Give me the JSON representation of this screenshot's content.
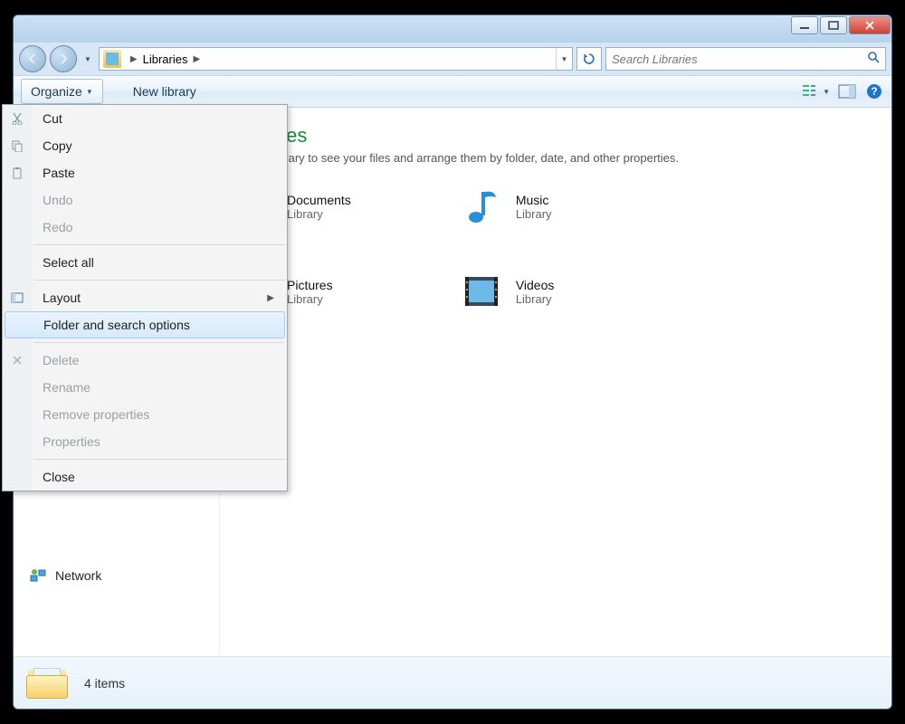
{
  "address": {
    "location": "Libraries"
  },
  "search": {
    "placeholder": "Search Libraries"
  },
  "toolbar": {
    "organize": "Organize",
    "newlib": "New library"
  },
  "organize_menu": {
    "cut": "Cut",
    "copy": "Copy",
    "paste": "Paste",
    "undo": "Undo",
    "redo": "Redo",
    "select_all": "Select all",
    "layout": "Layout",
    "folder_opts": "Folder and search options",
    "delete": "Delete",
    "rename": "Rename",
    "remove_props": "Remove properties",
    "properties": "Properties",
    "close": "Close"
  },
  "content": {
    "title_suffix": "ies",
    "subtitle_suffix": "brary to see your files and arrange them by folder, date, and other properties.",
    "type_label": "Library",
    "items": {
      "documents": "Documents",
      "music": "Music",
      "pictures": "Pictures",
      "videos": "Videos"
    }
  },
  "sidebar": {
    "network": "Network"
  },
  "status": {
    "count": "4 items"
  }
}
